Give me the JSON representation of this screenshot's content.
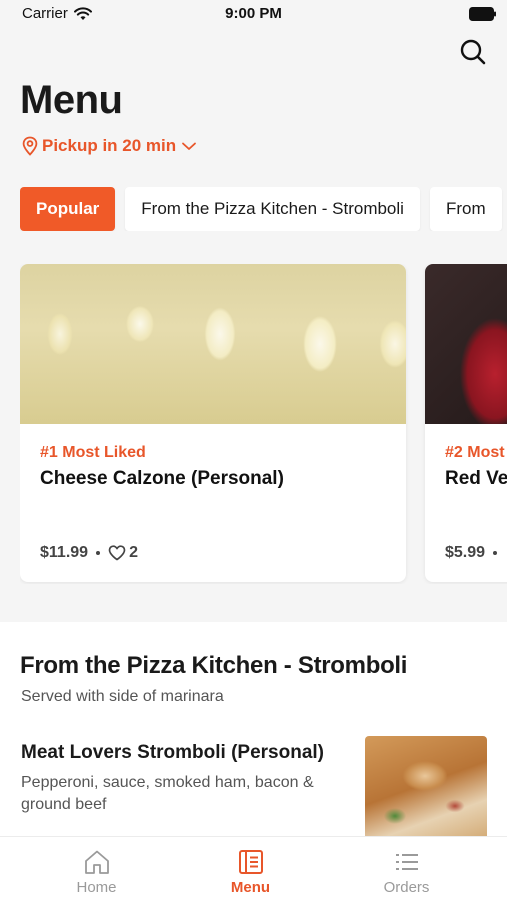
{
  "status_bar": {
    "carrier": "Carrier",
    "time": "9:00 PM"
  },
  "header": {
    "title": "Menu",
    "pickup": "Pickup in 20 min"
  },
  "categories": [
    {
      "label": "Popular",
      "active": true
    },
    {
      "label": "From the Pizza Kitchen - Stromboli",
      "active": false
    },
    {
      "label": "From",
      "active": false
    }
  ],
  "featured": [
    {
      "rank": "#1 Most Liked",
      "name": "Cheese Calzone (Personal)",
      "price": "$11.99",
      "likes": "2"
    },
    {
      "rank": "#2 Most",
      "name": "Red Ve",
      "price": "$5.99",
      "likes": ""
    }
  ],
  "section": {
    "title": "From the Pizza Kitchen - Stromboli",
    "subtitle": "Served with side of marinara",
    "items": [
      {
        "name": "Meat Lovers Stromboli (Personal)",
        "description": "Pepperoni, sauce, smoked ham, bacon & ground beef"
      }
    ]
  },
  "tabbar": {
    "items": [
      {
        "label": "Home",
        "icon": "home-icon",
        "active": false
      },
      {
        "label": "Menu",
        "icon": "menu-book-icon",
        "active": true
      },
      {
        "label": "Orders",
        "icon": "list-icon",
        "active": false
      }
    ]
  },
  "colors": {
    "accent": "#f05a28",
    "accent_text": "#e8562a",
    "background": "#f5f5f5"
  }
}
